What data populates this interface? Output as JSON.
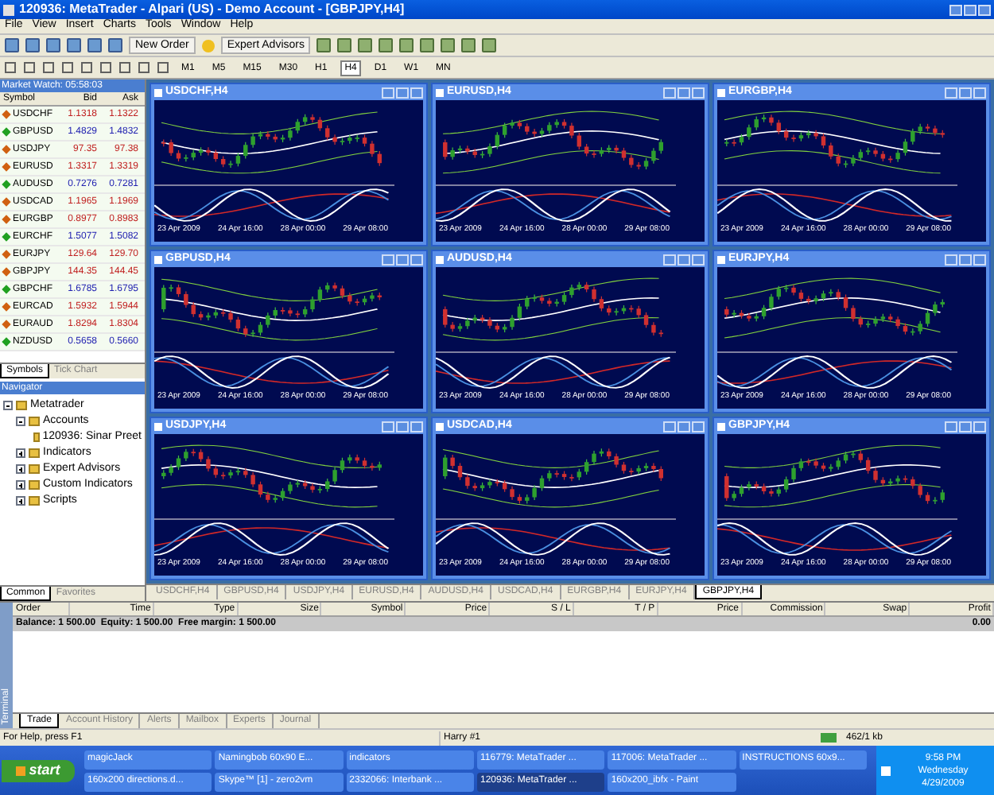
{
  "window": {
    "title": "120936: MetaTrader - Alpari (US) - Demo Account - [GBPJPY,H4]"
  },
  "menu": [
    "File",
    "View",
    "Insert",
    "Charts",
    "Tools",
    "Window",
    "Help"
  ],
  "toolbar": {
    "new_order": "New Order",
    "expert_advisors": "Expert Advisors"
  },
  "timeframes": [
    {
      "label": "M1",
      "selected": false
    },
    {
      "label": "M5",
      "selected": false
    },
    {
      "label": "M15",
      "selected": false
    },
    {
      "label": "M30",
      "selected": false
    },
    {
      "label": "H1",
      "selected": false
    },
    {
      "label": "H4",
      "selected": true
    },
    {
      "label": "D1",
      "selected": false
    },
    {
      "label": "W1",
      "selected": false
    },
    {
      "label": "MN",
      "selected": false
    }
  ],
  "market_watch": {
    "title": "Market Watch: 05:58:03",
    "columns": [
      "Symbol",
      "Bid",
      "Ask"
    ],
    "rows": [
      {
        "symbol": "USDCHF",
        "bid": "1.1318",
        "ask": "1.1322",
        "up": false
      },
      {
        "symbol": "GBPUSD",
        "bid": "1.4829",
        "ask": "1.4832",
        "up": true
      },
      {
        "symbol": "USDJPY",
        "bid": "97.35",
        "ask": "97.38",
        "up": false
      },
      {
        "symbol": "EURUSD",
        "bid": "1.3317",
        "ask": "1.3319",
        "up": false
      },
      {
        "symbol": "AUDUSD",
        "bid": "0.7276",
        "ask": "0.7281",
        "up": true
      },
      {
        "symbol": "USDCAD",
        "bid": "1.1965",
        "ask": "1.1969",
        "up": false
      },
      {
        "symbol": "EURGBP",
        "bid": "0.8977",
        "ask": "0.8983",
        "up": false
      },
      {
        "symbol": "EURCHF",
        "bid": "1.5077",
        "ask": "1.5082",
        "up": true
      },
      {
        "symbol": "EURJPY",
        "bid": "129.64",
        "ask": "129.70",
        "up": false
      },
      {
        "symbol": "GBPJPY",
        "bid": "144.35",
        "ask": "144.45",
        "up": false
      },
      {
        "symbol": "GBPCHF",
        "bid": "1.6785",
        "ask": "1.6795",
        "up": true
      },
      {
        "symbol": "EURCAD",
        "bid": "1.5932",
        "ask": "1.5944",
        "up": false
      },
      {
        "symbol": "EURAUD",
        "bid": "1.8294",
        "ask": "1.8304",
        "up": false
      },
      {
        "symbol": "NZDUSD",
        "bid": "0.5658",
        "ask": "0.5660",
        "up": true
      }
    ],
    "tabs": [
      {
        "label": "Symbols",
        "selected": true
      },
      {
        "label": "Tick Chart",
        "selected": false
      }
    ]
  },
  "navigator": {
    "title": "Navigator",
    "tree": [
      {
        "label": "Metatrader",
        "expanded": true,
        "children": [
          {
            "label": "Accounts",
            "expanded": true,
            "children": [
              {
                "label": "120936: Sinar Preet"
              }
            ]
          },
          {
            "label": "Indicators",
            "expanded": false
          },
          {
            "label": "Expert Advisors",
            "expanded": false
          },
          {
            "label": "Custom Indicators",
            "expanded": false
          },
          {
            "label": "Scripts",
            "expanded": false
          }
        ]
      }
    ],
    "tabs": [
      {
        "label": "Common",
        "selected": true
      },
      {
        "label": "Favorites",
        "selected": false
      }
    ]
  },
  "charts": [
    {
      "title": "USDCHF,H4",
      "dates": [
        "23 Apr 2009",
        "24 Apr 16:00",
        "28 Apr 00:00",
        "29 Apr 08:00"
      ]
    },
    {
      "title": "EURUSD,H4",
      "dates": [
        "23 Apr 2009",
        "24 Apr 16:00",
        "28 Apr 00:00",
        "29 Apr 08:00"
      ]
    },
    {
      "title": "EURGBP,H4",
      "dates": [
        "23 Apr 2009",
        "24 Apr 16:00",
        "28 Apr 00:00",
        "29 Apr 08:00"
      ]
    },
    {
      "title": "GBPUSD,H4",
      "dates": [
        "23 Apr 2009",
        "24 Apr 16:00",
        "28 Apr 00:00",
        "29 Apr 08:00"
      ]
    },
    {
      "title": "AUDUSD,H4",
      "dates": [
        "23 Apr 2009",
        "24 Apr 16:00",
        "28 Apr 00:00",
        "29 Apr 08:00"
      ]
    },
    {
      "title": "EURJPY,H4",
      "dates": [
        "23 Apr 2009",
        "24 Apr 16:00",
        "28 Apr 00:00",
        "29 Apr 08:00"
      ]
    },
    {
      "title": "USDJPY,H4",
      "dates": [
        "23 Apr 2009",
        "24 Apr 16:00",
        "28 Apr 00:00",
        "29 Apr 08:00"
      ]
    },
    {
      "title": "USDCAD,H4",
      "dates": [
        "23 Apr 2009",
        "24 Apr 16:00",
        "28 Apr 00:00",
        "29 Apr 08:00"
      ]
    },
    {
      "title": "GBPJPY,H4",
      "dates": [
        "23 Apr 2009",
        "24 Apr 16:00",
        "28 Apr 00:00",
        "29 Apr 08:00"
      ]
    }
  ],
  "chart_tabs": [
    {
      "label": "USDCHF,H4",
      "selected": false
    },
    {
      "label": "GBPUSD,H4",
      "selected": false
    },
    {
      "label": "USDJPY,H4",
      "selected": false
    },
    {
      "label": "EURUSD,H4",
      "selected": false
    },
    {
      "label": "AUDUSD,H4",
      "selected": false
    },
    {
      "label": "USDCAD,H4",
      "selected": false
    },
    {
      "label": "EURGBP,H4",
      "selected": false
    },
    {
      "label": "EURJPY,H4",
      "selected": false
    },
    {
      "label": "GBPJPY,H4",
      "selected": true
    }
  ],
  "terminal": {
    "label": "Terminal",
    "columns": [
      "Order",
      "Time",
      "Type",
      "Size",
      "Symbol",
      "Price",
      "S / L",
      "T / P",
      "Price",
      "Commission",
      "Swap",
      "Profit"
    ],
    "balance": "Balance: 1 500.00  Equity: 1 500.00  Free margin: 1 500.00",
    "profit": "0.00",
    "tabs": [
      {
        "label": "Trade",
        "selected": true
      },
      {
        "label": "Account History",
        "selected": false
      },
      {
        "label": "Alerts",
        "selected": false
      },
      {
        "label": "Mailbox",
        "selected": false
      },
      {
        "label": "Experts",
        "selected": false
      },
      {
        "label": "Journal",
        "selected": false
      }
    ]
  },
  "status_bar": {
    "help": "For Help, press F1",
    "profile": "Harry #1",
    "traffic": "462/1 kb"
  },
  "taskbar": {
    "start": "start",
    "buttons": [
      {
        "label": "magicJack",
        "selected": false
      },
      {
        "label": "Namingbob 60x90 E...",
        "selected": false
      },
      {
        "label": "indicators",
        "selected": false
      },
      {
        "label": "116779: MetaTrader ...",
        "selected": false
      },
      {
        "label": "117006: MetaTrader ...",
        "selected": false
      },
      {
        "label": "INSTRUCTIONS 60x9...",
        "selected": false
      },
      {
        "label": "160x200 directions.d...",
        "selected": false
      },
      {
        "label": "Skype™ [1] - zero2vm",
        "selected": false
      },
      {
        "label": "2332066: Interbank ...",
        "selected": false
      },
      {
        "label": "120936: MetaTrader ...",
        "selected": true
      },
      {
        "label": "160x200_ibfx - Paint",
        "selected": false
      }
    ],
    "time": "9:58 PM",
    "day": "Wednesday",
    "date": "4/29/2009"
  }
}
